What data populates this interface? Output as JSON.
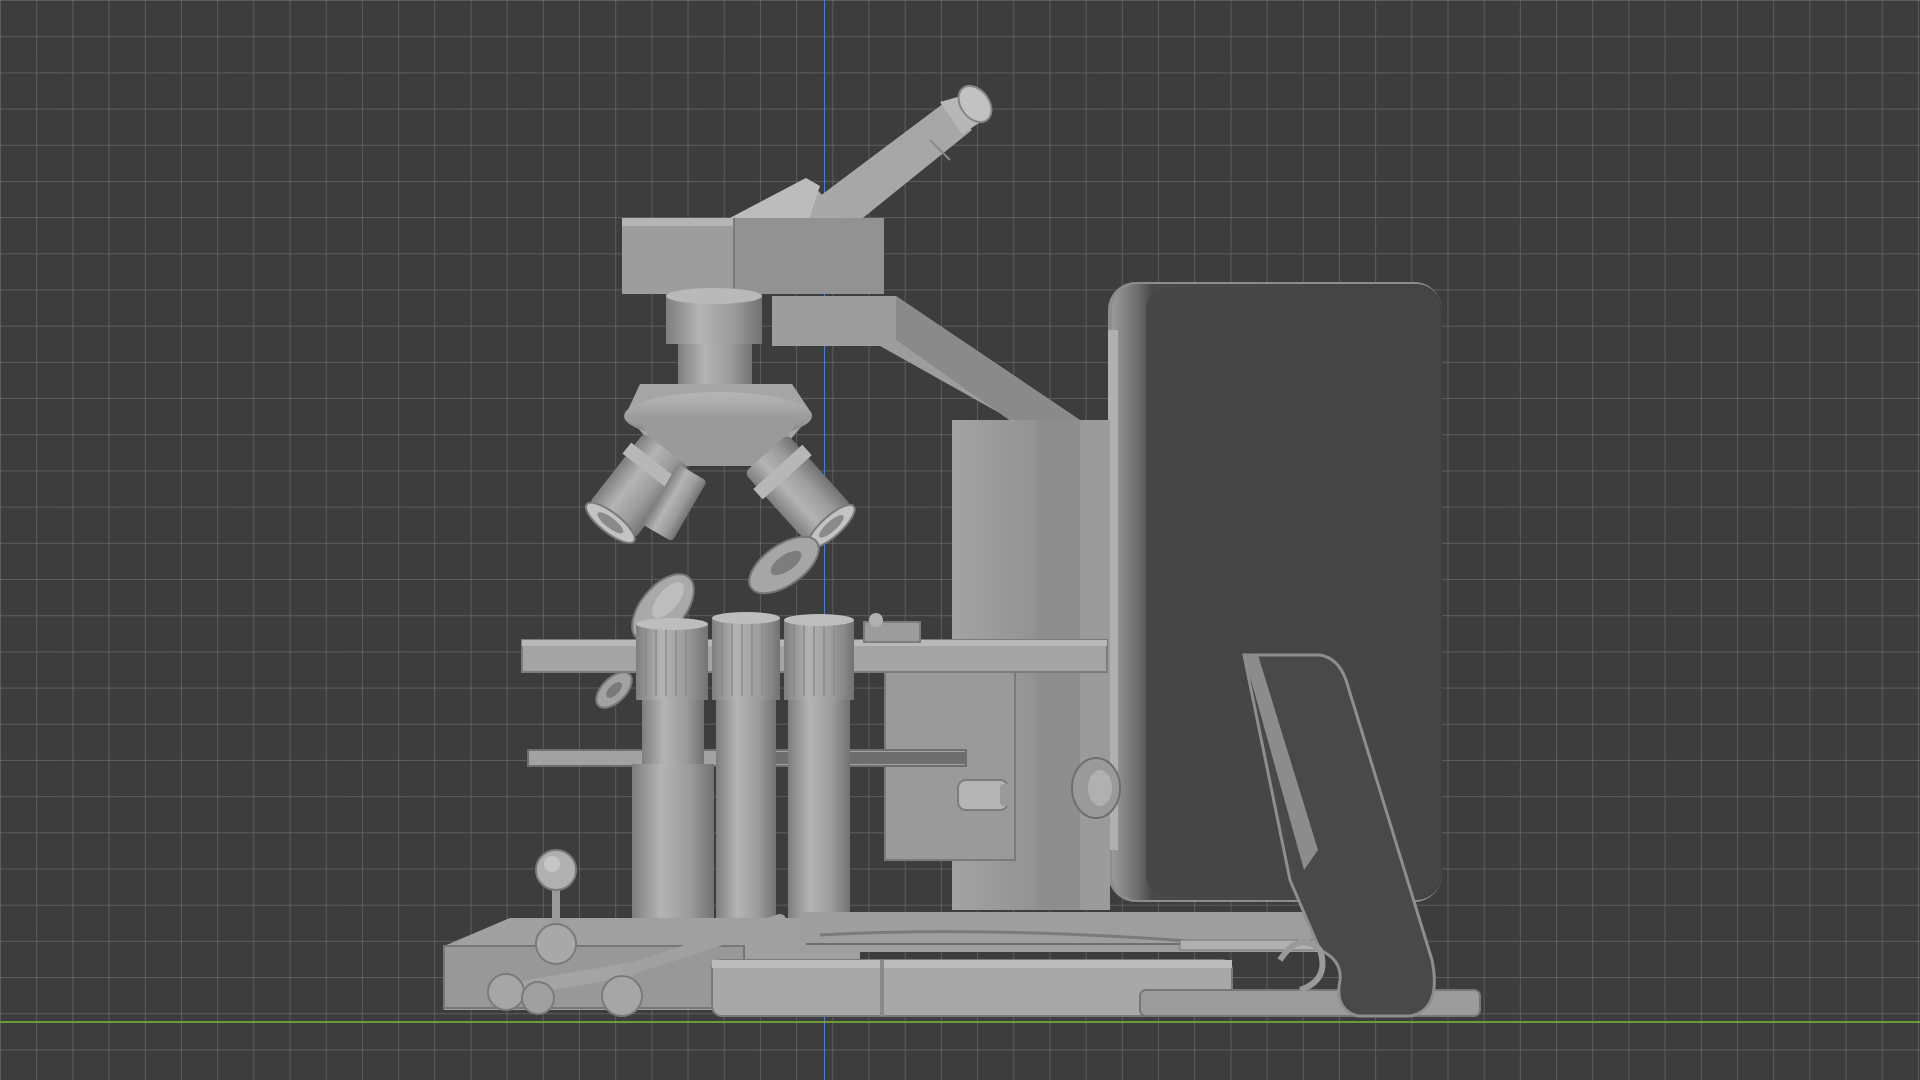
{
  "viewport": {
    "view": "orthographic-side",
    "shading": "solid",
    "grid_visible": true,
    "colors": {
      "background": "#3d3d3d",
      "grid": "#787878",
      "axis_z": "#4a7fd0",
      "axis_y": "#6f9a3a",
      "model_light": "#a6a6a6",
      "model_mid": "#8f8f8f",
      "model_dark": "#6c6c6c",
      "screen_face": "#4a4949"
    }
  },
  "scene_objects": [
    "microscope-head",
    "eyepiece-tube",
    "arm",
    "objective-turret",
    "stage",
    "stage-clip",
    "focus-knobs",
    "base-plate",
    "monitor-panel",
    "monitor-stand",
    "joystick"
  ]
}
